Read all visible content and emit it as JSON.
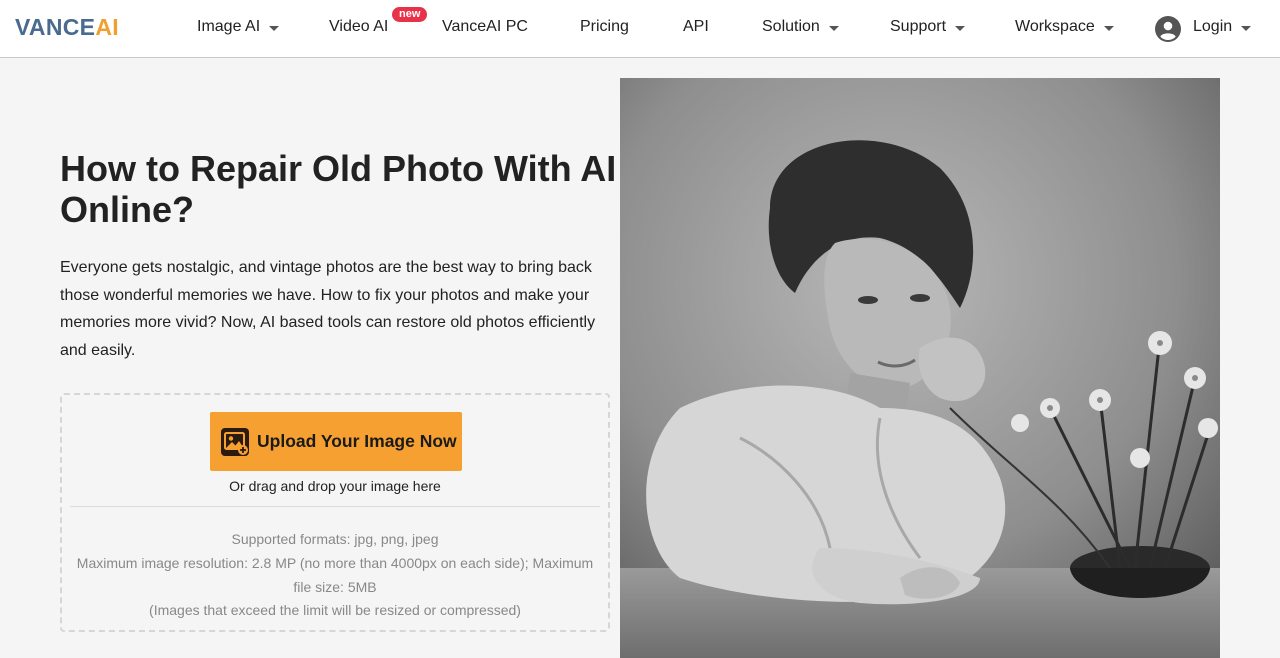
{
  "header": {
    "logo_part1": "VANCE",
    "logo_part2": "AI",
    "nav": {
      "image_ai": "Image AI",
      "video_ai": "Video AI",
      "video_badge": "new",
      "vanceai_pc": "VanceAI PC",
      "pricing": "Pricing",
      "api": "API",
      "solution": "Solution",
      "support": "Support",
      "workspace": "Workspace",
      "login": "Login"
    }
  },
  "hero": {
    "title": "How to Repair Old Photo With AI Online?",
    "intro": "Everyone gets nostalgic, and vintage photos are the best way to bring back those wonderful memories we have. How to fix your photos and make your memories more vivid? Now, AI based tools can restore old photos efficiently and easily."
  },
  "upload": {
    "button_label": "Upload Your Image Now",
    "drag_text": "Or drag and drop your image here",
    "formats": "Supported formats: jpg, png, jpeg",
    "limits": "Maximum image resolution: 2.8 MP (no more than 4000px on each side); Maximum file size: 5MB",
    "resize_note": "(Images that exceed the limit will be resized or compressed)"
  },
  "colors": {
    "accent": "#f5a030",
    "badge": "#e8324a",
    "logo_blue": "#4a6b8f"
  }
}
